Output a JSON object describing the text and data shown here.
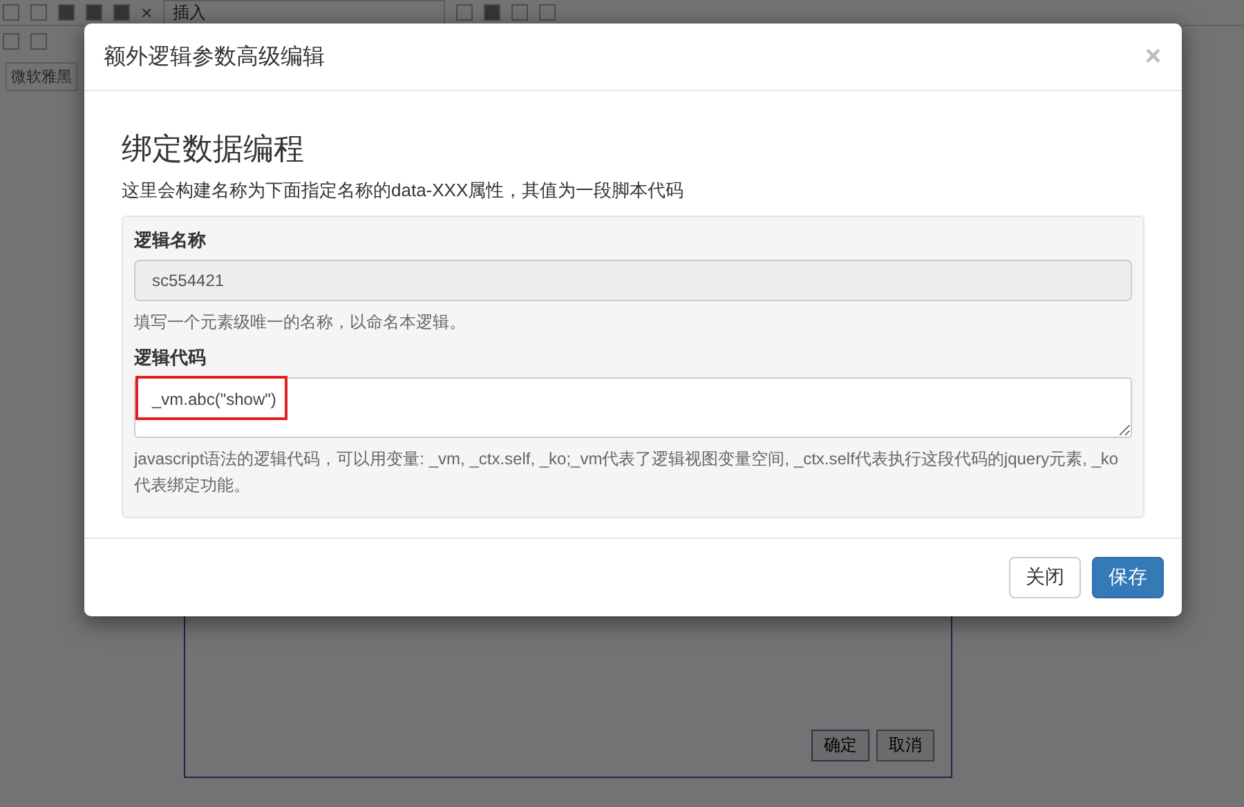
{
  "background": {
    "toolbar": {
      "dropdown": "插入",
      "close_glyph": "×"
    },
    "font_box": "微软雅黑",
    "dialog_buttons": [
      "确定",
      "取消"
    ]
  },
  "modal": {
    "title": "额外逻辑参数高级编辑",
    "close": "×",
    "heading": "绑定数据编程",
    "description": "这里会构建名称为下面指定名称的data-XXX属性，其值为一段脚本代码",
    "fields": [
      {
        "kind": "input",
        "label": "逻辑名称",
        "value": "sc554421",
        "help": "填写一个元素级唯一的名称，以命名本逻辑。",
        "highlighted": false
      },
      {
        "kind": "textarea",
        "label": "逻辑代码",
        "value": "_vm.abc(\"show\")",
        "help": "javascript语法的逻辑代码，可以用变量: _vm, _ctx.self, _ko;_vm代表了逻辑视图变量空间, _ctx.self代表执行这段代码的jquery元素, _ko代表绑定功能。",
        "highlighted": true
      }
    ],
    "buttons": [
      {
        "label": "关闭",
        "primary": false
      },
      {
        "label": "保存",
        "primary": true
      }
    ]
  }
}
